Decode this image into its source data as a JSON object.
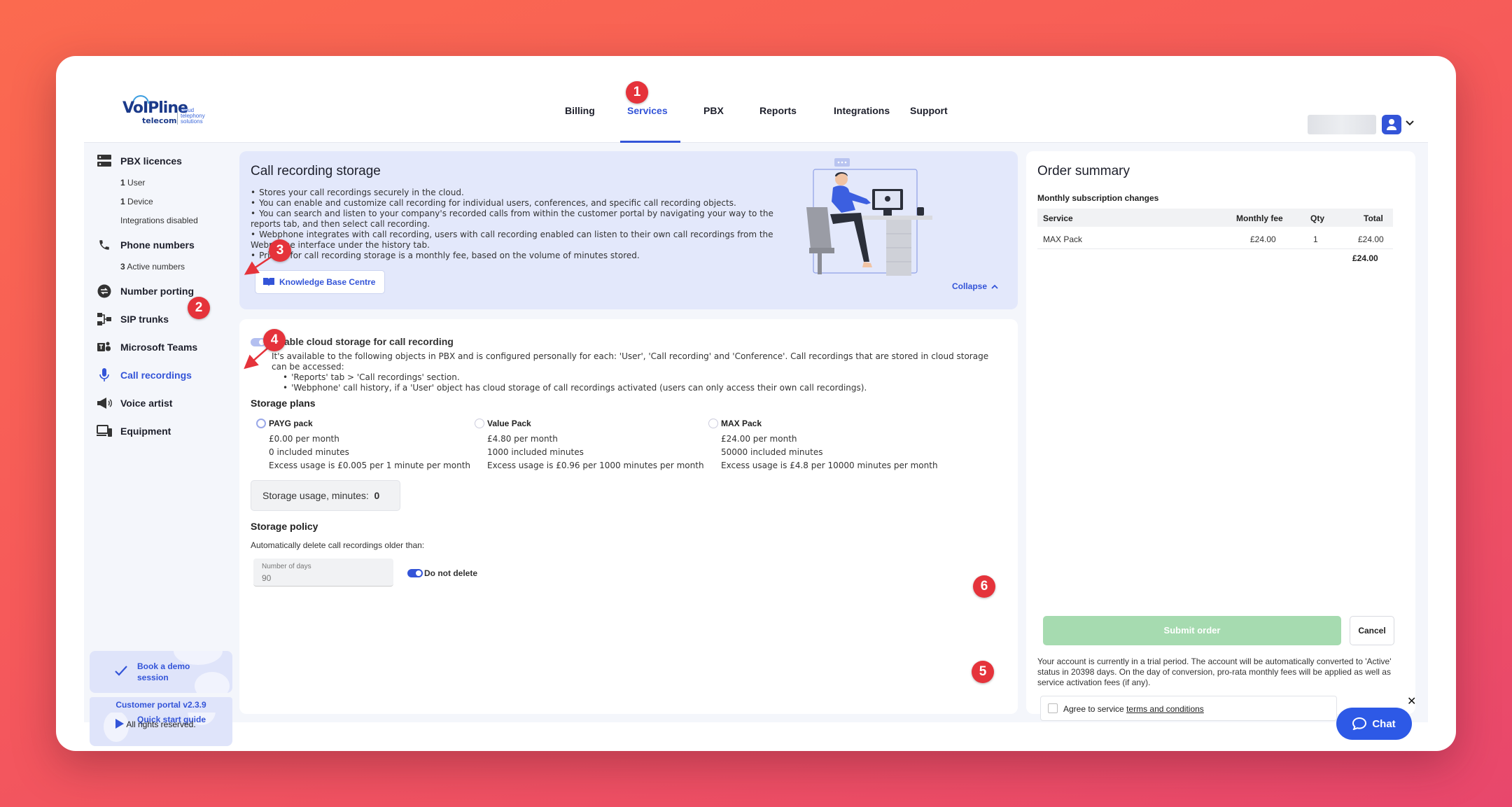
{
  "logo": {
    "brand": "VoIPline",
    "sub": "telecom",
    "tagline_1": "cloud",
    "tagline_2": "telephony",
    "tagline_3": "solutions"
  },
  "nav": {
    "items": [
      {
        "label": "Billing"
      },
      {
        "label": "Services"
      },
      {
        "label": "PBX"
      },
      {
        "label": "Reports"
      },
      {
        "label": "Integrations"
      },
      {
        "label": "Support"
      }
    ],
    "active": "Services"
  },
  "sidebar": {
    "items": [
      {
        "label": "PBX licences",
        "icon": "server-icon"
      },
      {
        "label": "Phone numbers",
        "icon": "phone-icon"
      },
      {
        "label": "Number porting",
        "icon": "porting-icon"
      },
      {
        "label": "SIP trunks",
        "icon": "sip-icon"
      },
      {
        "label": "Microsoft Teams",
        "icon": "teams-icon"
      },
      {
        "label": "Call recordings",
        "icon": "microphone-icon"
      },
      {
        "label": "Voice artist",
        "icon": "megaphone-icon"
      },
      {
        "label": "Equipment",
        "icon": "devices-icon"
      }
    ],
    "pbx_sub": {
      "users_count": "1",
      "users_label": "User",
      "devices_count": "1",
      "devices_label": "Device",
      "integrations": "Integrations disabled"
    },
    "phone_sub": {
      "count": "3",
      "label": "Active numbers"
    },
    "promo_demo": "Book a demo session",
    "promo_guide": "Quick start guide",
    "version": "Customer portal v2.3.9",
    "rights": "All rights reserved."
  },
  "info": {
    "title": "Call recording storage",
    "bullets": [
      "Stores your call recordings securely in the cloud.",
      "You can enable and customize call recording for individual users, conferences, and specific call recording objects.",
      "You can search and listen to your company's recorded calls from within the customer portal by navigating your way to the reports tab, and then select call recording.",
      "Webphone integrates with call recording, users with call recording enabled can listen to their own call recordings from the Webphone interface under the history tab.",
      "Pricing for call recording storage is a monthly fee, based on the volume of minutes stored."
    ],
    "kb_button": "Knowledge Base Centre",
    "collapse": "Collapse"
  },
  "storage": {
    "enable_label": "Enable cloud storage for call recording",
    "description": "It's available to the following objects in PBX and is configured personally for each: 'User', 'Call recording' and 'Conference'. Call recordings that are stored in cloud storage can be accessed:",
    "access_points": [
      "'Reports' tab > 'Call recordings' section.",
      "'Webphone' call history, if a 'User' object has cloud storage of call recordings activated (users can only access their own call recordings)."
    ],
    "plans_title": "Storage plans",
    "plans": [
      {
        "name": "PAYG pack",
        "price": "£0.00 per month",
        "included": "0 included minutes",
        "excess": "Excess usage is £0.005 per 1 minute per month"
      },
      {
        "name": "Value Pack",
        "price": "£4.80 per month",
        "included": "1000 included minutes",
        "excess": "Excess usage is £0.96 per 1000 minutes per month"
      },
      {
        "name": "MAX Pack",
        "price": "£24.00 per month",
        "included": "50000 included minutes",
        "excess": "Excess usage is £4.8 per 10000 minutes per month"
      }
    ],
    "usage_label": "Storage usage, minutes:",
    "usage_value": "0",
    "policy_title": "Storage policy",
    "policy_desc": "Automatically delete call recordings older than:",
    "days_label": "Number of days",
    "days_value": "90",
    "do_not_delete": "Do not delete"
  },
  "order": {
    "title": "Order summary",
    "subtitle": "Monthly subscription changes",
    "headers": {
      "service": "Service",
      "fee": "Monthly fee",
      "qty": "Qty",
      "total": "Total"
    },
    "rows": [
      {
        "service": "MAX Pack",
        "fee": "£24.00",
        "qty": "1",
        "total": "£24.00"
      }
    ],
    "grand_total": "£24.00",
    "submit": "Submit order",
    "cancel": "Cancel",
    "trial_notice": "Your account is currently in a trial period. The account will be automatically converted to 'Active' status in 20398 days. On the day of conversion, pro-rata monthly fees will be applied as well as service activation fees (if any).",
    "agree_prefix": "Agree to service",
    "agree_link": "terms and conditions"
  },
  "chat": {
    "label": "Chat",
    "close": "✕"
  },
  "markers": [
    "1",
    "2",
    "3",
    "4",
    "5",
    "6"
  ],
  "colors": {
    "accent": "#3354d8",
    "submit_disabled": "#a6dbb0",
    "marker": "#e5333b",
    "chat": "#2d59e6"
  }
}
